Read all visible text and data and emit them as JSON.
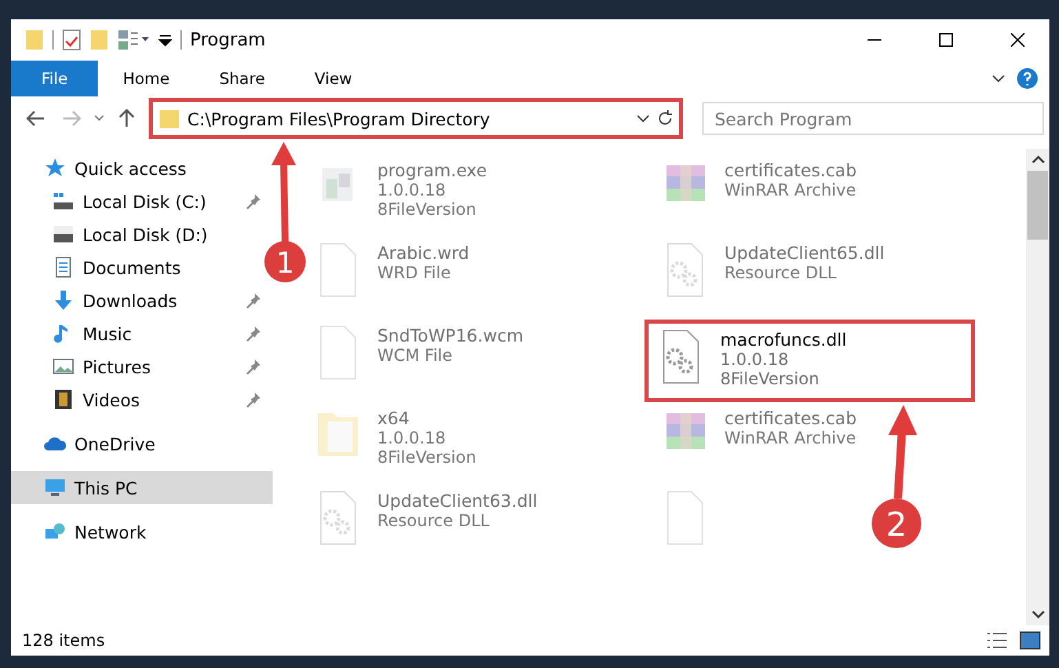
{
  "window": {
    "title": "Program"
  },
  "ribbon_tabs": [
    {
      "label": "File",
      "selected": true
    },
    {
      "label": "Home",
      "selected": false
    },
    {
      "label": "Share",
      "selected": false
    },
    {
      "label": "View",
      "selected": false
    }
  ],
  "address_bar": {
    "path": "C:\\Program Files\\Program Directory",
    "highlighted": true
  },
  "search": {
    "placeholder": "Search Program"
  },
  "sidebar": {
    "items": [
      {
        "label": "Quick access",
        "selected": false,
        "pinned": false,
        "children": [
          {
            "label": "Local Disk (C:)",
            "selected": false,
            "pinned": true
          },
          {
            "label": "Local Disk (D:)",
            "selected": false,
            "pinned": false
          },
          {
            "label": "Documents",
            "selected": false,
            "pinned": false
          },
          {
            "label": "Downloads",
            "selected": false,
            "pinned": true
          },
          {
            "label": "Music",
            "selected": false,
            "pinned": true
          },
          {
            "label": "Pictures",
            "selected": false,
            "pinned": true
          },
          {
            "label": "Videos",
            "selected": false,
            "pinned": true
          }
        ]
      },
      {
        "label": "OneDrive",
        "selected": false,
        "pinned": false
      },
      {
        "label": "This PC",
        "selected": true,
        "pinned": false
      },
      {
        "label": "Network",
        "selected": false,
        "pinned": false
      }
    ]
  },
  "files": [
    {
      "name": "program.exe",
      "lines": [
        "1.0.0.18",
        "8FileVersion"
      ],
      "highlighted": false
    },
    {
      "name": "certificates.cab",
      "lines": [
        "WinRAR Archive"
      ],
      "highlighted": false
    },
    {
      "name": "Arabic.wrd",
      "lines": [
        "WRD File"
      ],
      "highlighted": false
    },
    {
      "name": "UpdateClient65.dll",
      "lines": [
        "Resource DLL"
      ],
      "highlighted": false
    },
    {
      "name": "SndToWP16.wcm",
      "lines": [
        "WCM File"
      ],
      "highlighted": false
    },
    {
      "name": "macrofuncs.dll",
      "lines": [
        "1.0.0.18",
        "8FileVersion"
      ],
      "highlighted": true
    },
    {
      "name": "x64",
      "lines": [
        "1.0.0.18",
        "8FileVersion"
      ],
      "highlighted": false
    },
    {
      "name": "certificates.cab",
      "lines": [
        "WinRAR Archive"
      ],
      "highlighted": false
    },
    {
      "name": "UpdateClient63.dll",
      "lines": [
        "Resource DLL"
      ],
      "highlighted": false
    },
    {
      "highlighted": false
    }
  ],
  "status_bar": {
    "item_count": "128 items"
  },
  "annotations": [
    {
      "number": "1"
    },
    {
      "number": "2"
    }
  ]
}
